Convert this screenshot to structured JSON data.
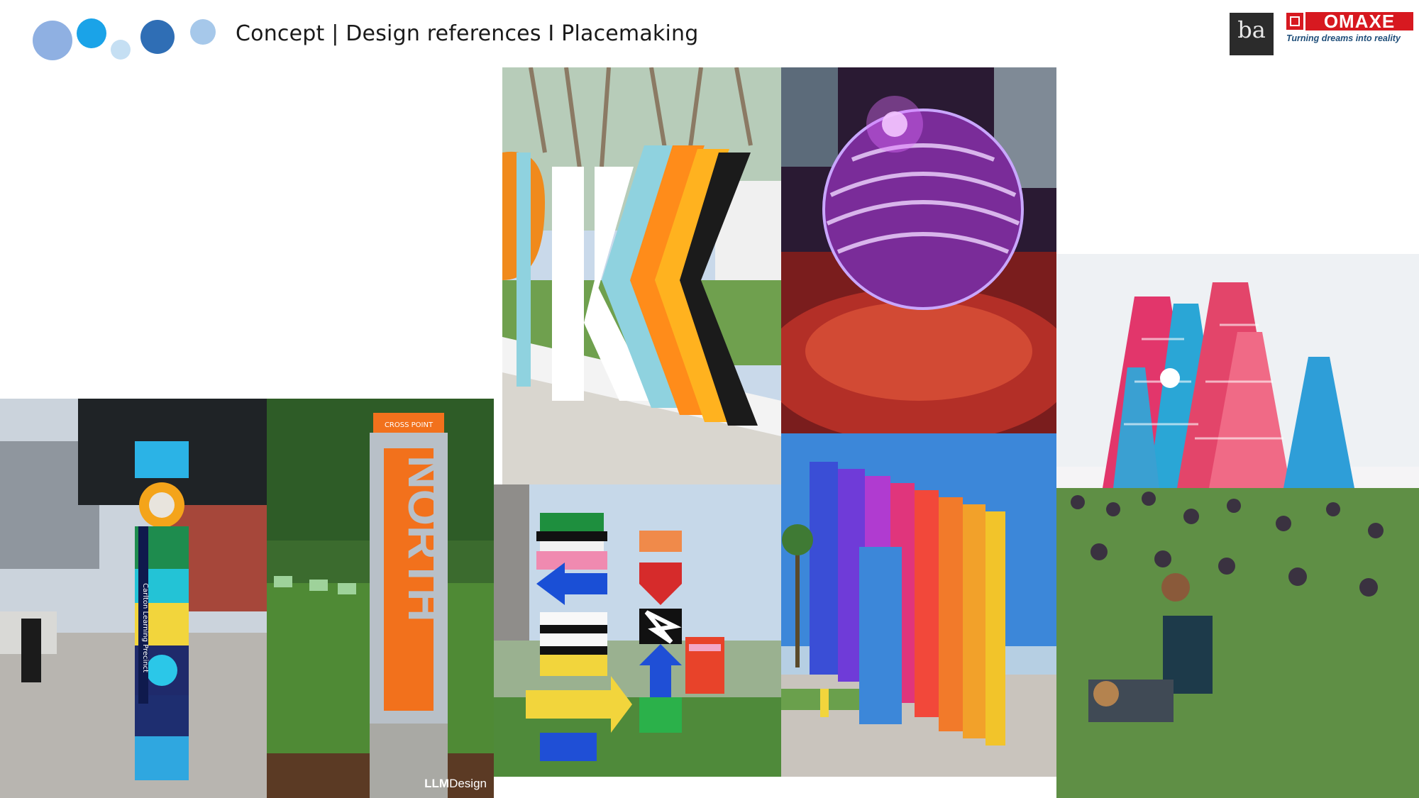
{
  "header": {
    "title": "Concept  |  Design references I Placemaking",
    "bubble_colors": [
      "#8fb0e2",
      "#1aa3e8",
      "#c5dff3",
      "#2f6eb5",
      "#a6c8ea"
    ]
  },
  "logos": {
    "ba": {
      "mark": "ba"
    },
    "omaxe": {
      "name": "OMAXE",
      "tagline": "Turning dreams into reality",
      "brand_color": "#d71920"
    }
  },
  "photos": [
    {
      "id": "park-letters"
    },
    {
      "id": "illuminated-sphere"
    },
    {
      "id": "festival-cones"
    },
    {
      "id": "carlton-totem",
      "sign_text": "Carlton Learning Precinct"
    },
    {
      "id": "north-pylon",
      "sign_text": "NORTH",
      "top_text": "CROSS POINT",
      "credit_bold": "LLM",
      "credit_light": "Design"
    },
    {
      "id": "arrow-stacks"
    },
    {
      "id": "rainbow-arch"
    }
  ]
}
